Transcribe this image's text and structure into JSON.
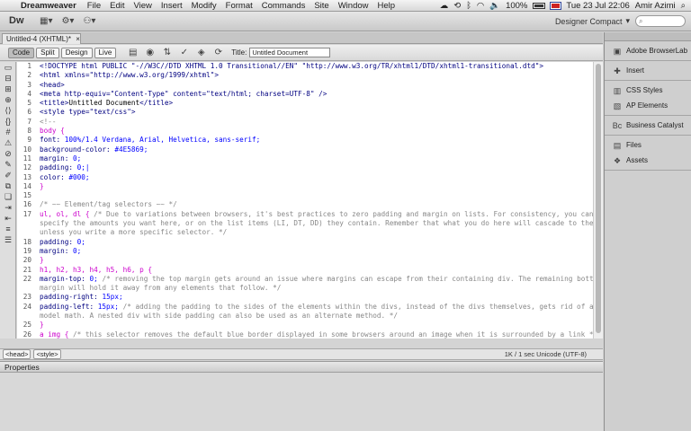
{
  "menubar": {
    "apple": "",
    "items": [
      "Dreamweaver",
      "File",
      "Edit",
      "View",
      "Insert",
      "Modify",
      "Format",
      "Commands",
      "Site",
      "Window",
      "Help"
    ],
    "battery": "100%",
    "clock": "Tue 23 Jul  22:06",
    "user": "Amir Azimi"
  },
  "appbar": {
    "logo": "Dw",
    "workspace": "Designer Compact"
  },
  "doc": {
    "tab_label": "Untitled-4 (XHTML)*",
    "views": [
      "Code",
      "Split",
      "Design",
      "Live"
    ],
    "title_label": "Title:",
    "title_value": "Untitled Document"
  },
  "code": {
    "lines": [
      {
        "n": "1",
        "parts": [
          {
            "c": "c-tag",
            "t": "<!DOCTYPE html PUBLIC \"-//W3C//DTD XHTML 1.0 Transitional//EN\" \"http://www.w3.org/TR/xhtml1/DTD/xhtml1-transitional.dtd\">"
          }
        ]
      },
      {
        "n": "2",
        "parts": [
          {
            "c": "c-tag",
            "t": "<html xmlns=\"http://www.w3.org/1999/xhtml\">"
          }
        ]
      },
      {
        "n": "3",
        "parts": [
          {
            "c": "c-tag",
            "t": "<head>"
          }
        ]
      },
      {
        "n": "4",
        "parts": [
          {
            "c": "c-tag",
            "t": "<meta http-equiv=\"Content-Type\" content=\"text/html; charset=UTF-8\" />"
          }
        ]
      },
      {
        "n": "5",
        "parts": [
          {
            "c": "c-tag",
            "t": "<title>"
          },
          {
            "c": "c-plain",
            "t": "Untitled Document"
          },
          {
            "c": "c-tag",
            "t": "</title>"
          }
        ]
      },
      {
        "n": "6",
        "parts": [
          {
            "c": "c-tag",
            "t": "<style type=\"text/css\">"
          }
        ]
      },
      {
        "n": "7",
        "parts": [
          {
            "c": "c-com",
            "t": "<!--"
          }
        ]
      },
      {
        "n": "8",
        "parts": [
          {
            "c": "c-sel",
            "t": "body {"
          }
        ]
      },
      {
        "n": "9",
        "parts": [
          {
            "c": "c-prop",
            "t": "    font: "
          },
          {
            "c": "c-val",
            "t": "100%/1.4 Verdana, Arial, Helvetica, sans-serif;"
          }
        ]
      },
      {
        "n": "10",
        "parts": [
          {
            "c": "c-prop",
            "t": "    background-color: "
          },
          {
            "c": "c-val",
            "t": "#4E5869;"
          }
        ]
      },
      {
        "n": "11",
        "parts": [
          {
            "c": "c-prop",
            "t": "    margin: "
          },
          {
            "c": "c-val",
            "t": "0;"
          }
        ]
      },
      {
        "n": "12",
        "parts": [
          {
            "c": "c-prop",
            "t": "    padding: "
          },
          {
            "c": "c-val",
            "t": "0;|"
          }
        ]
      },
      {
        "n": "13",
        "parts": [
          {
            "c": "c-prop",
            "t": "    color: "
          },
          {
            "c": "c-val",
            "t": "#000;"
          }
        ]
      },
      {
        "n": "14",
        "parts": [
          {
            "c": "c-sel",
            "t": "}"
          }
        ]
      },
      {
        "n": "15",
        "parts": [
          {
            "c": "c-plain",
            "t": ""
          }
        ]
      },
      {
        "n": "16",
        "parts": [
          {
            "c": "c-com",
            "t": "/* ~~ Element/tag selectors ~~ */"
          }
        ]
      },
      {
        "n": "17",
        "parts": [
          {
            "c": "c-sel",
            "t": "ul, ol, dl { "
          },
          {
            "c": "c-com",
            "t": "/* Due to variations between browsers, it's best practices to zero padding and margin on lists. For consistency, you can either"
          }
        ]
      },
      {
        "n": "",
        "parts": [
          {
            "c": "c-com",
            "t": "specify the amounts you want here, or on the list items (LI, DT, DD) they contain. Remember that what you do here will cascade to the .nav list"
          }
        ]
      },
      {
        "n": "",
        "parts": [
          {
            "c": "c-com",
            "t": "unless you write a more specific selector. */"
          }
        ]
      },
      {
        "n": "18",
        "parts": [
          {
            "c": "c-prop",
            "t": "    padding: "
          },
          {
            "c": "c-val",
            "t": "0;"
          }
        ]
      },
      {
        "n": "19",
        "parts": [
          {
            "c": "c-prop",
            "t": "    margin: "
          },
          {
            "c": "c-val",
            "t": "0;"
          }
        ]
      },
      {
        "n": "20",
        "parts": [
          {
            "c": "c-sel",
            "t": "}"
          }
        ]
      },
      {
        "n": "21",
        "parts": [
          {
            "c": "c-sel",
            "t": "h1, h2, h3, h4, h5, h6, p {"
          }
        ]
      },
      {
        "n": "22",
        "parts": [
          {
            "c": "c-prop",
            "t": "    margin-top: "
          },
          {
            "c": "c-val",
            "t": "0;"
          },
          {
            "c": "c-com",
            "t": "   /* removing the top margin gets around an issue where margins can escape from their containing div. The remaining bottom"
          }
        ]
      },
      {
        "n": "",
        "parts": [
          {
            "c": "c-com",
            "t": "margin will hold it away from any elements that follow. */"
          }
        ]
      },
      {
        "n": "23",
        "parts": [
          {
            "c": "c-prop",
            "t": "    padding-right: "
          },
          {
            "c": "c-val",
            "t": "15px;"
          }
        ]
      },
      {
        "n": "24",
        "parts": [
          {
            "c": "c-prop",
            "t": "    padding-left: "
          },
          {
            "c": "c-val",
            "t": "15px;"
          },
          {
            "c": "c-com",
            "t": " /* adding the padding to the sides of the elements within the divs, instead of the divs themselves, gets rid of any box"
          }
        ]
      },
      {
        "n": "",
        "parts": [
          {
            "c": "c-com",
            "t": "model math. A nested div with side padding can also be used as an alternate method. */"
          }
        ]
      },
      {
        "n": "25",
        "parts": [
          {
            "c": "c-sel",
            "t": "}"
          }
        ]
      },
      {
        "n": "26",
        "parts": [
          {
            "c": "c-sel",
            "t": "a img { "
          },
          {
            "c": "c-com",
            "t": "/* this selector removes the default blue border displayed in some browsers around an image when it is surrounded by a link */"
          }
        ]
      },
      {
        "n": "27",
        "parts": [
          {
            "c": "c-prop",
            "t": "    border: "
          },
          {
            "c": "c-val",
            "t": "none;"
          }
        ]
      }
    ]
  },
  "status": {
    "crumbs": [
      "<head>",
      "<style>"
    ],
    "info": "1K / 1 sec  Unicode (UTF-8)"
  },
  "properties": {
    "title": "Properties"
  },
  "panels": {
    "items": [
      {
        "label": "Adobe BrowserLab",
        "icon": "browserlab-icon"
      },
      {
        "label": "Insert",
        "icon": "insert-icon"
      },
      {
        "label": "CSS Styles",
        "icon": "css-styles-icon"
      },
      {
        "label": "AP Elements",
        "icon": "ap-elements-icon"
      },
      {
        "label": "Business Catalyst",
        "icon": "business-catalyst-icon"
      },
      {
        "label": "Files",
        "icon": "files-icon"
      },
      {
        "label": "Assets",
        "icon": "assets-icon"
      }
    ]
  }
}
